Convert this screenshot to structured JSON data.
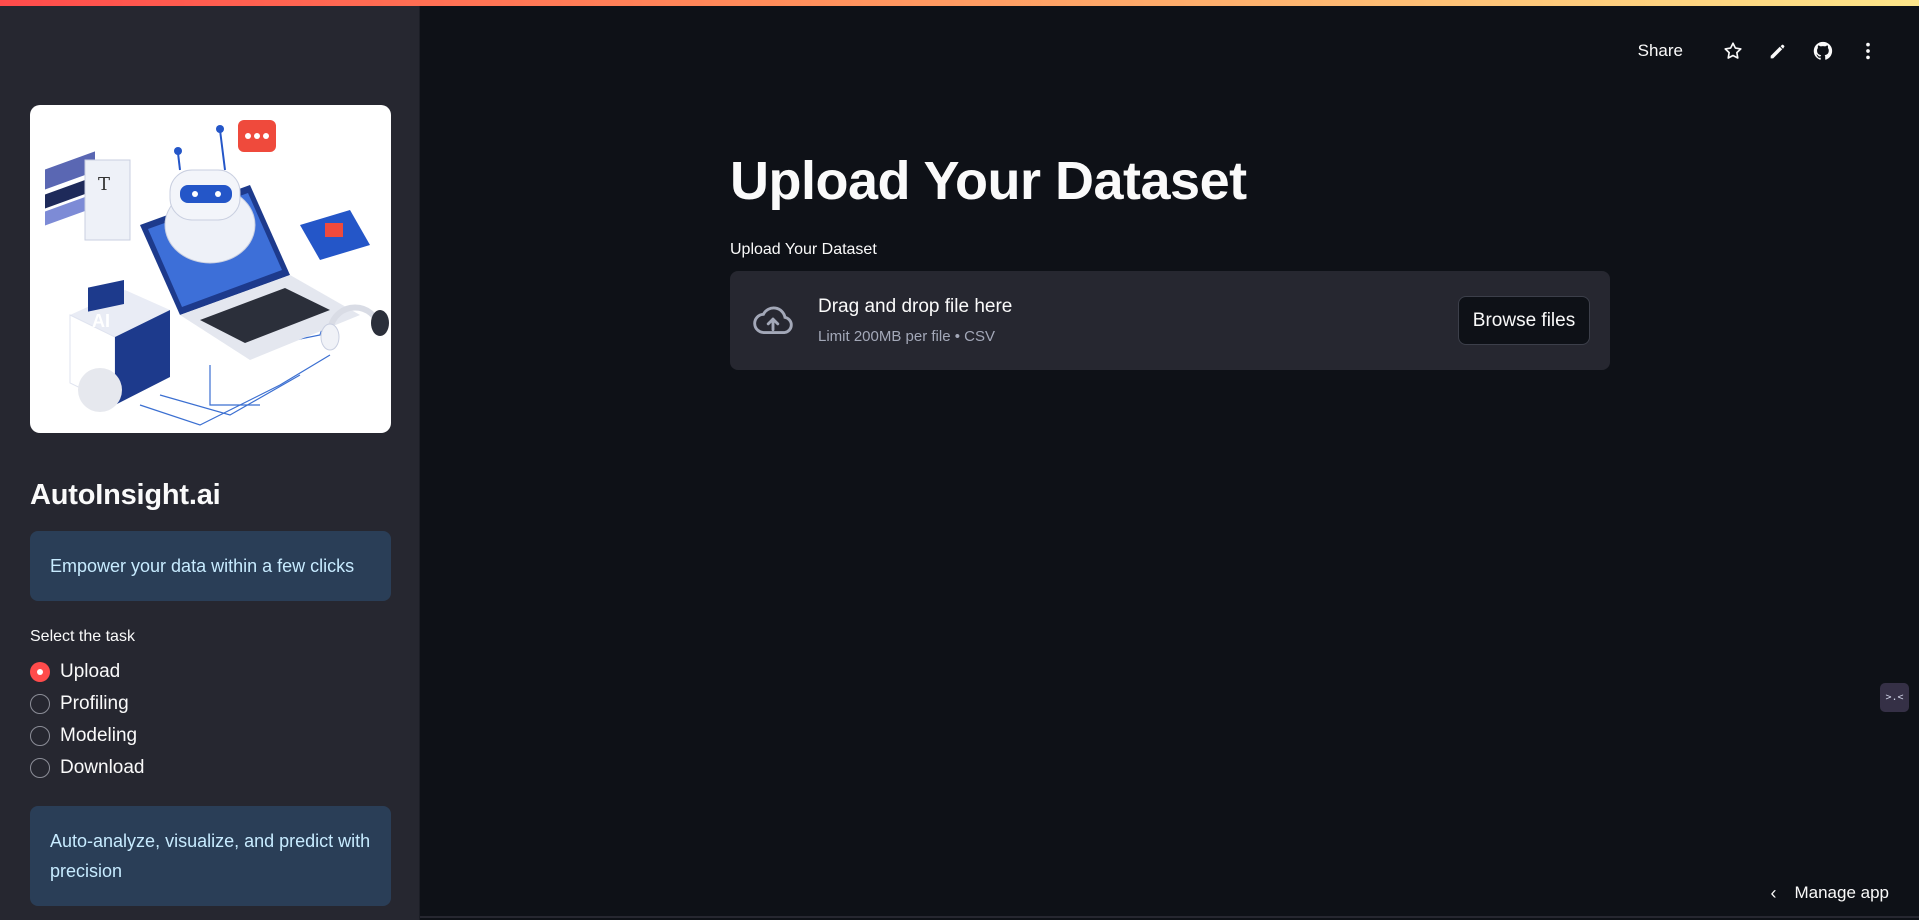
{
  "sidebar": {
    "app_title": "AutoInsight.ai",
    "tagline": "Empower your data within a few clicks",
    "task_label": "Select the task",
    "tasks": [
      {
        "label": "Upload",
        "checked": true
      },
      {
        "label": "Profiling",
        "checked": false
      },
      {
        "label": "Modeling",
        "checked": false
      },
      {
        "label": "Download",
        "checked": false
      }
    ],
    "footer_info": "Auto-analyze, visualize, and predict with precision",
    "hero_icons": [
      "robot-icon",
      "laptop-icon",
      "ai-chip-icon",
      "books-icon",
      "headphones-icon",
      "chat-bubble-icon",
      "phone-icon"
    ],
    "hero_chip_text": "AI"
  },
  "toolbar": {
    "share_label": "Share",
    "icons": [
      "star-icon",
      "edit-icon",
      "github-icon",
      "more-vertical-icon"
    ]
  },
  "main": {
    "title": "Upload Your Dataset",
    "uploader_label": "Upload Your Dataset",
    "drop_title": "Drag and drop file here",
    "drop_sub": "Limit 200MB per file • CSV",
    "browse_label": "Browse files"
  },
  "footer": {
    "manage_app_label": "Manage app"
  },
  "widget": {
    "glyph": ">.<"
  },
  "colors": {
    "background": "#0e1117",
    "sidebar": "#262730",
    "accent": "#ff4b4b",
    "info_text": "#c7ebff"
  }
}
